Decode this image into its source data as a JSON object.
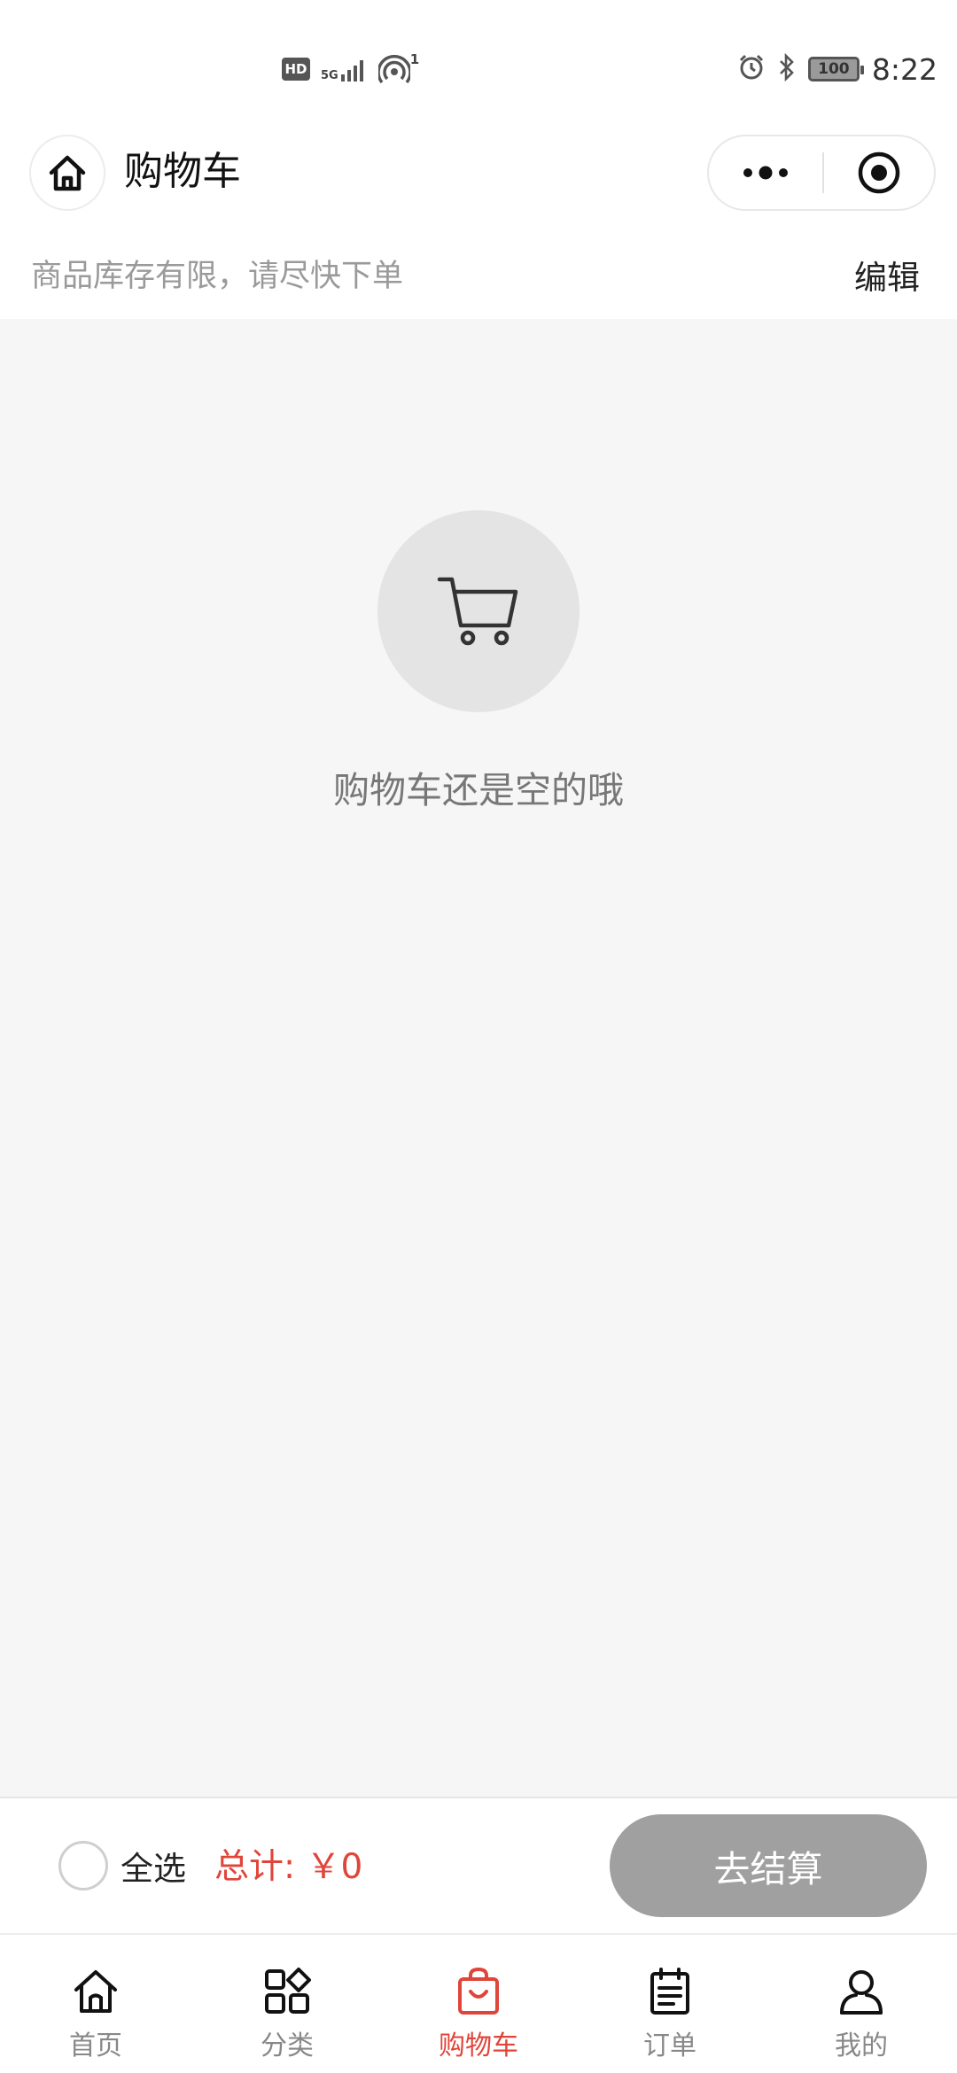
{
  "status_bar": {
    "hd": "HD",
    "network": "5G",
    "hotspot_count": "1",
    "battery": "100",
    "time": "8:22"
  },
  "nav": {
    "title": "购物车"
  },
  "notice": {
    "text": "商品库存有限，请尽快下单",
    "edit_label": "编辑"
  },
  "empty_state": {
    "message": "购物车还是空的哦"
  },
  "summary": {
    "select_all_label": "全选",
    "total_text": "总计: ￥0",
    "checkout_label": "去结算"
  },
  "tabs": [
    {
      "label": "首页",
      "icon": "home-icon",
      "active": false
    },
    {
      "label": "分类",
      "icon": "category-icon",
      "active": false
    },
    {
      "label": "购物车",
      "icon": "shopping-bag-icon",
      "active": true
    },
    {
      "label": "订单",
      "icon": "order-icon",
      "active": false
    },
    {
      "label": "我的",
      "icon": "profile-icon",
      "active": false
    }
  ],
  "colors": {
    "accent": "#e0453a",
    "disabled_button": "#a0a0a0",
    "page_background": "#f6f6f6"
  }
}
